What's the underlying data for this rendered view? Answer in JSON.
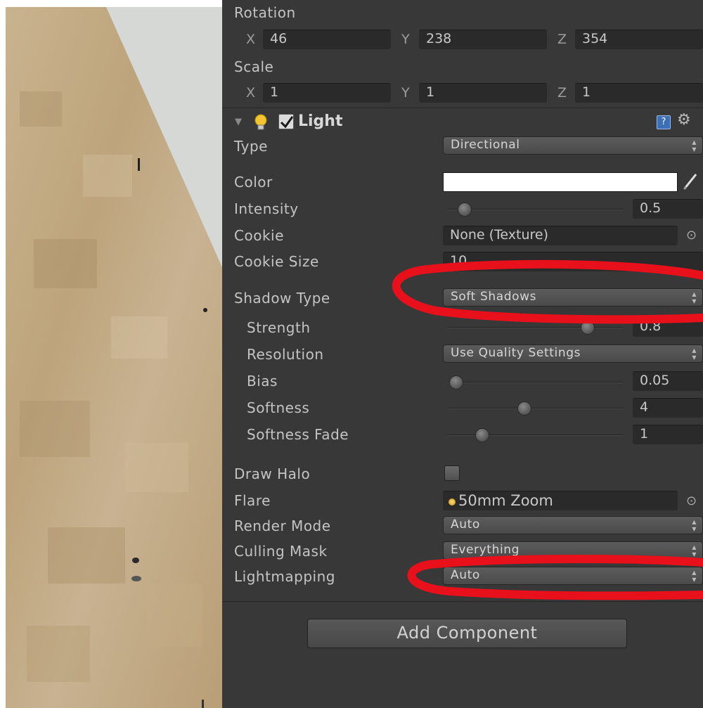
{
  "transform": {
    "rotation_label": "Rotation",
    "scale_label": "Scale",
    "rotation": {
      "x_axis": "X",
      "x": "46",
      "y_axis": "Y",
      "y": "238",
      "z_axis": "Z",
      "z": "354"
    },
    "scale": {
      "x_axis": "X",
      "x": "1",
      "y_axis": "Y",
      "y": "1",
      "z_axis": "Z",
      "z": "1"
    }
  },
  "light": {
    "title": "Light",
    "enabled": true,
    "icons": {
      "collapse": "triangle-down-icon",
      "component": "lightbulb-icon",
      "help": "help-book-icon",
      "settings": "gear-icon"
    },
    "type_label": "Type",
    "type_value": "Directional",
    "color_label": "Color",
    "color_value": "#ffffff",
    "intensity_label": "Intensity",
    "intensity_value": "0.5",
    "intensity_fraction": 0.1,
    "cookie_label": "Cookie",
    "cookie_value": "None (Texture)",
    "cookie_size_label": "Cookie Size",
    "cookie_size_value": "10",
    "shadow_type_label": "Shadow Type",
    "shadow_type_value": "Soft Shadows",
    "strength_label": "Strength",
    "strength_value": "0.8",
    "strength_fraction": 0.8,
    "resolution_label": "Resolution",
    "resolution_value": "Use Quality Settings",
    "bias_label": "Bias",
    "bias_value": "0.05",
    "bias_fraction": 0.05,
    "softness_label": "Softness",
    "softness_value": "4",
    "softness_fraction": 0.44,
    "softness_fade_label": "Softness Fade",
    "softness_fade_value": "1",
    "softness_fade_fraction": 0.2,
    "draw_halo_label": "Draw Halo",
    "draw_halo_checked": false,
    "flare_label": "Flare",
    "flare_value": "50mm Zoom",
    "render_mode_label": "Render Mode",
    "render_mode_value": "Auto",
    "culling_mask_label": "Culling Mask",
    "culling_mask_value": "Everything",
    "lightmapping_label": "Lightmapping",
    "lightmapping_value": "Auto"
  },
  "add_component_label": "Add Component",
  "colors": {
    "panel_bg": "#383838",
    "field_bg": "#2a2a2a",
    "annotation": "#e8101a",
    "viewport_sky": "#d6d8d6",
    "viewport_ground": "#c4ac86"
  }
}
